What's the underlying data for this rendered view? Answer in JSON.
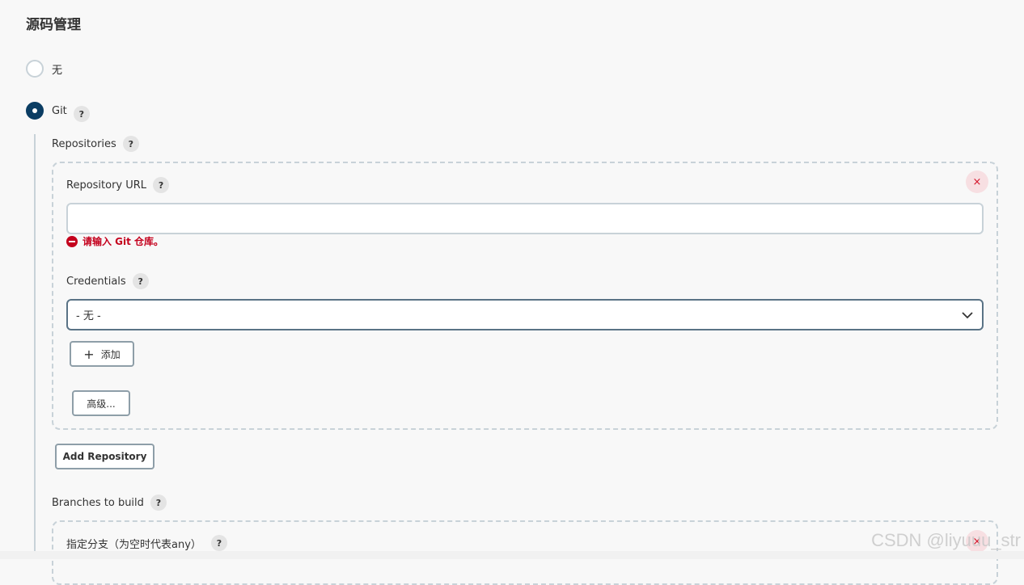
{
  "section": {
    "title": "源码管理"
  },
  "scm_options": [
    {
      "label": "无",
      "checked": false
    },
    {
      "label": "Git",
      "checked": true
    }
  ],
  "help_symbol": "?",
  "git": {
    "repositories_label": "Repositories",
    "repository": {
      "url_label": "Repository URL",
      "url_value": "",
      "url_error": "请输入 Git 仓库。",
      "credentials_label": "Credentials",
      "credentials_selected": "- 无 -",
      "add_button_icon": "+",
      "add_button_label": "添加",
      "advanced_button_label": "高级...",
      "delete_icon": "×"
    },
    "add_repository_label": "Add Repository",
    "branches_label": "Branches to build",
    "branch": {
      "specifier_label": "指定分支（为空时代表any）",
      "delete_icon": "×"
    }
  },
  "watermark": "CSDN @liyuuu_str",
  "colors": {
    "accent": "#0b3d63",
    "error": "#c4001d",
    "delete": "#d4142a"
  }
}
